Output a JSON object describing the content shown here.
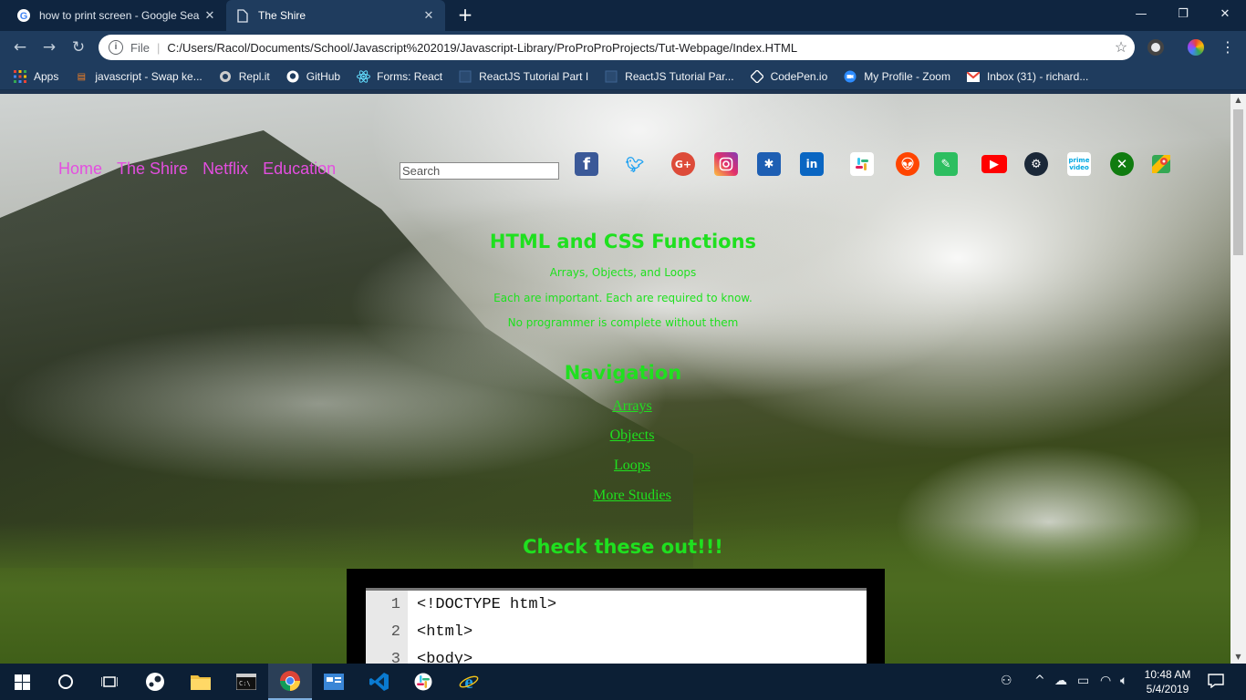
{
  "browser": {
    "tabs": [
      {
        "title": "how to print screen - Google Sea",
        "icon": "google-icon"
      },
      {
        "title": "The Shire",
        "icon": "document-icon"
      }
    ],
    "new_tab": "+",
    "window_controls": {
      "minimize": "—",
      "maximize": "❐",
      "close": "✕"
    },
    "address": {
      "scheme_label": "File",
      "url": "C:/Users/Racol/Documents/School/Javascript%202019/Javascript-Library/ProProProProjects/Tut-Webpage/Index.HTML"
    },
    "bookmarks": [
      {
        "label": "Apps",
        "icon": "apps-grid-icon"
      },
      {
        "label": "javascript - Swap ke...",
        "icon": "stackoverflow-icon"
      },
      {
        "label": "Repl.it",
        "icon": "replit-icon"
      },
      {
        "label": "GitHub",
        "icon": "github-icon"
      },
      {
        "label": "Forms: React",
        "icon": "react-icon"
      },
      {
        "label": "ReactJS Tutorial Part I",
        "icon": "page-icon"
      },
      {
        "label": "ReactJS Tutorial Par...",
        "icon": "page-icon"
      },
      {
        "label": "CodePen.io",
        "icon": "codepen-icon"
      },
      {
        "label": "My Profile - Zoom",
        "icon": "zoom-icon"
      },
      {
        "label": "Inbox (31) - richard...",
        "icon": "gmail-icon"
      }
    ]
  },
  "page": {
    "nav": [
      "Home",
      "The Shire",
      "Netflix",
      "Education"
    ],
    "search_placeholder": "Search",
    "social_icons": [
      "facebook-icon",
      "twitter-icon",
      "google-plus-icon",
      "instagram-icon",
      "myspace-icon",
      "linkedin-icon",
      "slack-icon",
      "reddit-icon",
      "evernote-icon",
      "youtube-icon",
      "steam-icon",
      "prime-video-icon",
      "xbox-icon",
      "google-maps-icon"
    ],
    "heading": "HTML and CSS Functions",
    "lines": [
      "Arrays, Objects, and Loops",
      "Each are important. Each are required to know.",
      "No programmer is complete without them"
    ],
    "nav_heading": "Navigation",
    "nav_links": [
      "Arrays",
      "Objects",
      "Loops",
      "More Studies"
    ],
    "check_heading": "Check these out!!!",
    "code_sample": [
      {
        "num": "1",
        "text": "<!DOCTYPE html>"
      },
      {
        "num": "2",
        "text": "<html>"
      },
      {
        "num": "3",
        "text": "<body>"
      }
    ]
  },
  "taskbar": {
    "time": "10:48 AM",
    "date": "5/4/2019"
  },
  "colors": {
    "nav_link": "#e44ee0",
    "page_text": "#1fe01f",
    "browser_dark": "#0f2540",
    "browser_toolbar": "#1f3c5e"
  }
}
